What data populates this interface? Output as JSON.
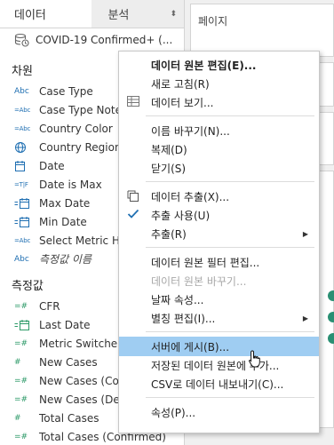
{
  "data_pane": {
    "tab_data": "데이터",
    "tab_analysis": "분석",
    "tab_analysis_caret": "⬍",
    "datasource_name": "COVID-19 Confirmed+ (...",
    "dimensions_header": "차원",
    "dimensions": [
      {
        "icon": "Abc",
        "label": "Case Type"
      },
      {
        "icon": "=Abc",
        "label": "Case Type Note"
      },
      {
        "icon": "=Abc",
        "label": "Country Color"
      },
      {
        "icon": "globe",
        "label": "Country Region"
      },
      {
        "icon": "calendar",
        "label": "Date"
      },
      {
        "icon": "=T|F",
        "label": "Date is Max"
      },
      {
        "icon": "=date",
        "label": "Max Date"
      },
      {
        "icon": "=date",
        "label": "Min Date"
      },
      {
        "icon": "=Abc",
        "label": "Select Metric He"
      },
      {
        "icon": "Abc",
        "label": "측정값 이름"
      }
    ],
    "measures_header": "측정값",
    "measures": [
      {
        "icon": "=#",
        "label": "CFR"
      },
      {
        "icon": "=date",
        "label": "Last Date"
      },
      {
        "icon": "=#",
        "label": "Metric Switcher"
      },
      {
        "icon": "#",
        "label": "New Cases"
      },
      {
        "icon": "=#",
        "label": "New Cases (Con"
      },
      {
        "icon": "=#",
        "label": "New Cases (Dea"
      },
      {
        "icon": "#",
        "label": "Total Cases"
      },
      {
        "icon": "=#",
        "label": "Total Cases (Confirmed)"
      }
    ]
  },
  "workspace": {
    "pages_title": "페이지"
  },
  "context_menu": {
    "items": [
      {
        "label": "데이터 원본 편집(E)...",
        "bold": true
      },
      {
        "label": "새로 고침(R)"
      },
      {
        "label": "데이터 보기...",
        "icon": "table-icon"
      },
      {
        "sep": true
      },
      {
        "label": "이름 바꾸기(N)..."
      },
      {
        "label": "복제(D)"
      },
      {
        "label": "닫기(S)"
      },
      {
        "sep": true
      },
      {
        "label": "데이터 추출(X)...",
        "icon": "extract-icon"
      },
      {
        "label": "추출 사용(U)",
        "icon": "check-icon"
      },
      {
        "label": "추출(R)",
        "submenu": true
      },
      {
        "sep": true
      },
      {
        "label": "데이터 원본 필터 편집..."
      },
      {
        "label": "데이터 원본 바꾸기...",
        "disabled": true
      },
      {
        "label": "날짜 속성..."
      },
      {
        "label": "별칭 편집(I)...",
        "submenu": true
      },
      {
        "sep": true
      },
      {
        "label": "서버에 게시(B)...",
        "highlight": true
      },
      {
        "label": "저장된 데이터 원본에 추가..."
      },
      {
        "label": "CSV로 데이터 내보내기(C)..."
      },
      {
        "sep": true
      },
      {
        "label": "속성(P)..."
      }
    ]
  },
  "colors": {
    "accent_blue": "#1f6fb2",
    "measure_green": "#2d9a68",
    "highlight": "#9fcdf2"
  }
}
